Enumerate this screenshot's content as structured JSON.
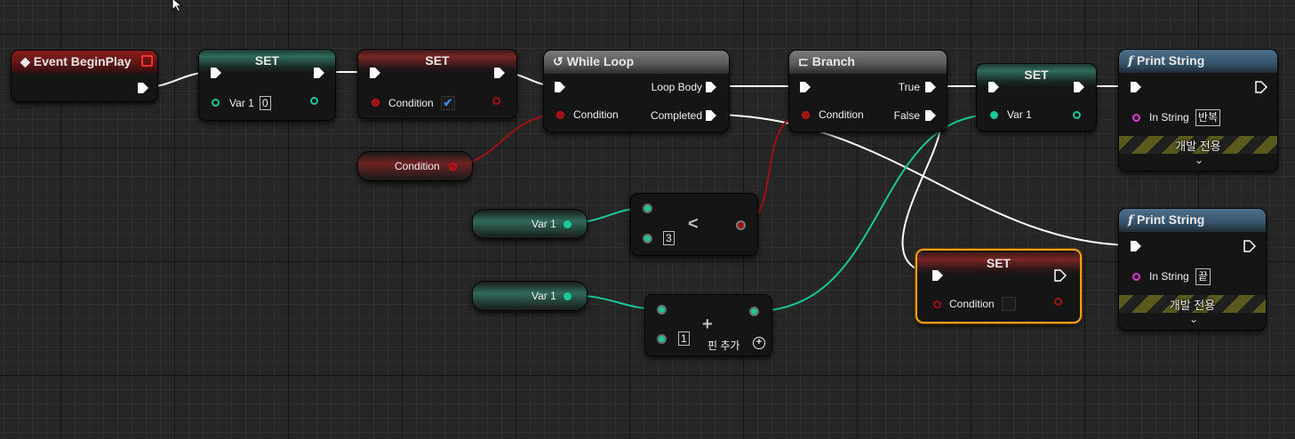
{
  "nodes": {
    "event_beginplay": {
      "title": "Event BeginPlay"
    },
    "set_var1": {
      "title": "SET",
      "pin_label": "Var 1",
      "value": "0"
    },
    "set_condition": {
      "title": "SET",
      "pin_label": "Condition",
      "checked": "✔"
    },
    "while_loop": {
      "title": "While Loop",
      "pin_condition": "Condition",
      "out_loop_body": "Loop Body",
      "out_completed": "Completed"
    },
    "branch": {
      "title": "Branch",
      "pin_condition": "Condition",
      "out_true": "True",
      "out_false": "False"
    },
    "set_var1_b": {
      "title": "SET",
      "pin_label": "Var 1"
    },
    "print_string_1": {
      "title": "Print String",
      "pin_label": "In String",
      "value": "반복",
      "banner": "개발 전용"
    },
    "print_string_2": {
      "title": "Print String",
      "pin_label": "In String",
      "value": "끝",
      "banner": "개발 전용"
    },
    "get_condition": {
      "label": "Condition"
    },
    "get_var1_a": {
      "label": "Var 1"
    },
    "get_var1_b": {
      "label": "Var 1"
    },
    "less_than": {
      "operator": "<",
      "value": "3"
    },
    "add": {
      "operator": "+",
      "value": "1",
      "add_pin": "핀 추가"
    },
    "set_condition_b": {
      "title": "SET",
      "pin_label": "Condition"
    }
  },
  "colors": {
    "exec": "#ffffff",
    "float_pin": "#19c79a",
    "bool_pin": "#a01010",
    "string_pin": "#e23ad6",
    "selection": "#f4a00f"
  },
  "icons": [
    "event-diamond-icon",
    "loop-icon",
    "branch-icon",
    "function-icon",
    "mouse-cursor-icon"
  ]
}
